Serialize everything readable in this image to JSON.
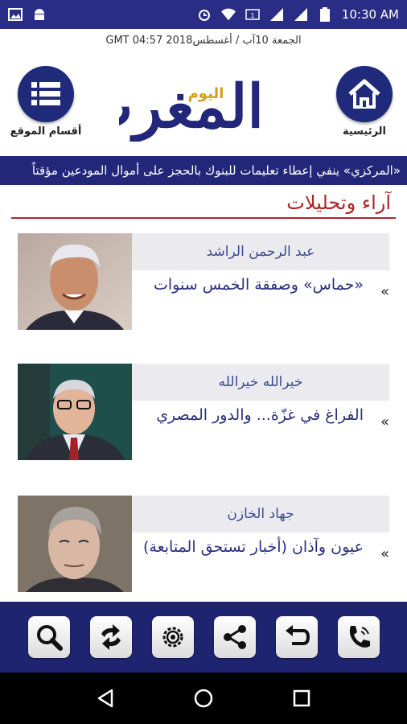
{
  "status_bar": {
    "time": "10:30 AM",
    "left_icons": [
      "image-icon",
      "android-icon"
    ],
    "right_icons": [
      "alarm-icon",
      "wifi-icon",
      "data-icon",
      "signal-icon",
      "signal-icon",
      "battery-icon"
    ]
  },
  "header": {
    "date": "الجمعة 10آب / أغسطس2018  GMT 04:57",
    "home_label": "الرئيسية",
    "sections_label": "أقسام الموقع",
    "logo_text": "المغرب",
    "logo_sub": "اليوم"
  },
  "ticker": {
    "text": "«المركزي» ينفي إعطاء تعليمات للبنوك بالحجز على أموال المودعين مؤقتاً"
  },
  "section": {
    "title": "آراء وتحليلات"
  },
  "articles": [
    {
      "author": "عبد الرحمن الراشد",
      "headline": "«حماس» وصفقة الخمس سنوات"
    },
    {
      "author": "خيرالله خيرالله",
      "headline": "الفراغ في غزّة... والدور المصري"
    },
    {
      "author": "جهاد الخازن",
      "headline": "عيون وآذان (أخبار تستحق المتابعة)"
    }
  ],
  "toolbar": [
    "search-icon",
    "refresh-icon",
    "settings-icon",
    "share-icon",
    "back-icon",
    "call-icon"
  ],
  "colors": {
    "primary": "#23277a",
    "accent": "#b22222",
    "headline": "#2b2e7d"
  }
}
